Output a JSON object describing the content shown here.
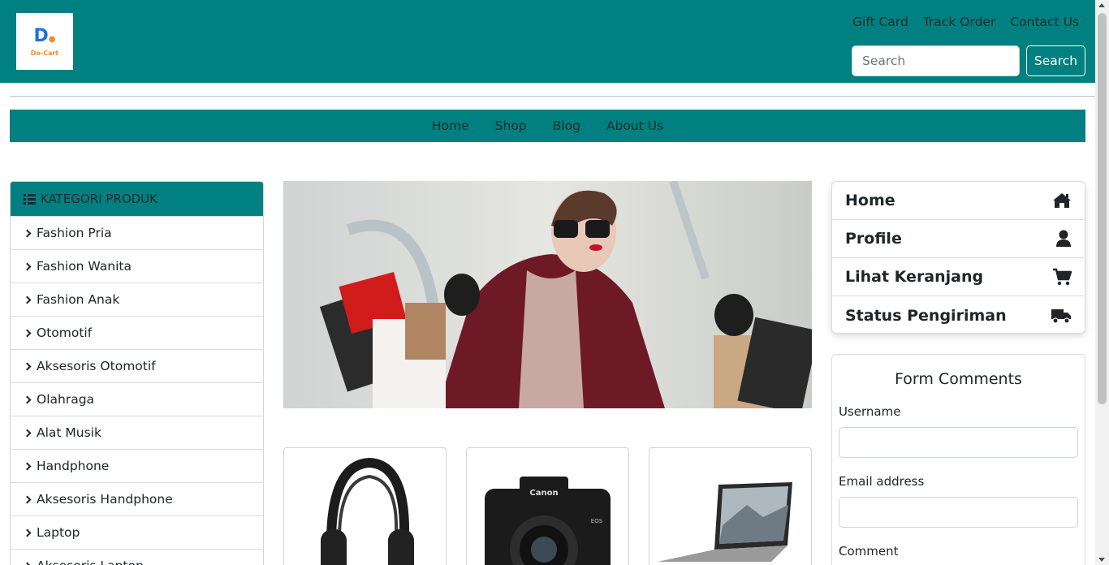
{
  "brand": {
    "logo_text": "Do-Cart"
  },
  "header": {
    "links": [
      "Gift Card",
      "Track Order",
      "Contact Us"
    ],
    "search_placeholder": "Search",
    "search_button": "Search",
    "bg_color": "#008080"
  },
  "nav": {
    "items": [
      "Home",
      "Shop",
      "Blog",
      "About Us"
    ]
  },
  "categories": {
    "title": "KATEGORI PRODUK",
    "items": [
      "Fashion Pria",
      "Fashion Wanita",
      "Fashion Anak",
      "Otomotif",
      "Aksesoris Otomotif",
      "Olahraga",
      "Alat Musik",
      "Handphone",
      "Aksesoris Handphone",
      "Laptop",
      "Aksesoris Laptop"
    ]
  },
  "hero": {
    "icon": "shopping-woman-photo"
  },
  "products": [
    {
      "icon": "headphones-photo"
    },
    {
      "icon": "camera-photo"
    },
    {
      "icon": "laptop-photo"
    }
  ],
  "side_menu": {
    "items": [
      {
        "label": "Home",
        "icon": "home-icon"
      },
      {
        "label": "Profile",
        "icon": "user-icon"
      },
      {
        "label": "Lihat Keranjang",
        "icon": "cart-icon"
      },
      {
        "label": "Status Pengiriman",
        "icon": "truck-icon"
      }
    ]
  },
  "form": {
    "title": "Form Comments",
    "username_label": "Username",
    "email_label": "Email address",
    "comment_label": "Comment"
  }
}
